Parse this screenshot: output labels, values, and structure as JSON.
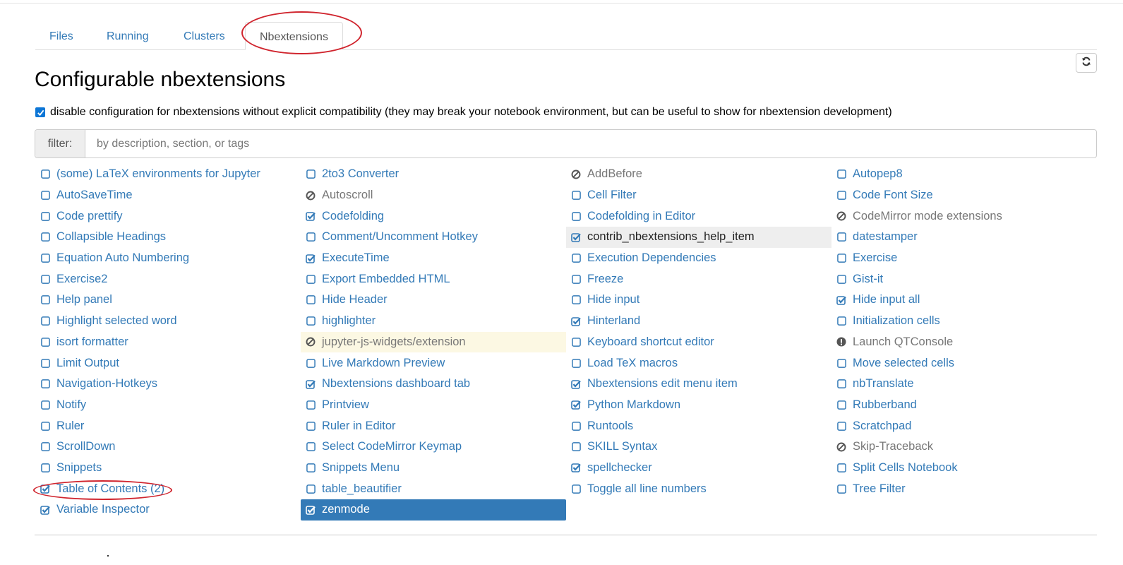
{
  "tabs": [
    {
      "label": "Files",
      "active": false
    },
    {
      "label": "Running",
      "active": false
    },
    {
      "label": "Clusters",
      "active": false
    },
    {
      "label": "Nbextensions",
      "active": true
    }
  ],
  "page_title": "Configurable nbextensions",
  "compat_checkbox": {
    "checked": true,
    "label": "disable configuration for nbextensions without explicit compatibility (they may break your notebook environment, but can be useful to show for nbextension development)"
  },
  "filter": {
    "label": "filter:",
    "placeholder": "by description, section, or tags"
  },
  "refresh_icon": "refresh-icon",
  "annotation_color": "#d0252e",
  "columns": [
    [
      {
        "label": "(some) LaTeX environments for Jupyter",
        "state": "unchecked"
      },
      {
        "label": "AutoSaveTime",
        "state": "unchecked"
      },
      {
        "label": "Code prettify",
        "state": "unchecked"
      },
      {
        "label": "Collapsible Headings",
        "state": "unchecked"
      },
      {
        "label": "Equation Auto Numbering",
        "state": "unchecked"
      },
      {
        "label": "Exercise2",
        "state": "unchecked"
      },
      {
        "label": "Help panel",
        "state": "unchecked"
      },
      {
        "label": "Highlight selected word",
        "state": "unchecked"
      },
      {
        "label": "isort formatter",
        "state": "unchecked"
      },
      {
        "label": "Limit Output",
        "state": "unchecked"
      },
      {
        "label": "Navigation-Hotkeys",
        "state": "unchecked"
      },
      {
        "label": "Notify",
        "state": "unchecked"
      },
      {
        "label": "Ruler",
        "state": "unchecked"
      },
      {
        "label": "ScrollDown",
        "state": "unchecked"
      },
      {
        "label": "Snippets",
        "state": "unchecked"
      },
      {
        "label": "Table of Contents (2)",
        "state": "checked",
        "circled": true
      },
      {
        "label": "Variable Inspector",
        "state": "checked"
      }
    ],
    [
      {
        "label": "2to3 Converter",
        "state": "unchecked"
      },
      {
        "label": "Autoscroll",
        "state": "disabled"
      },
      {
        "label": "Codefolding",
        "state": "checked"
      },
      {
        "label": "Comment/Uncomment Hotkey",
        "state": "unchecked"
      },
      {
        "label": "ExecuteTime",
        "state": "checked"
      },
      {
        "label": "Export Embedded HTML",
        "state": "unchecked"
      },
      {
        "label": "Hide Header",
        "state": "unchecked"
      },
      {
        "label": "highlighter",
        "state": "unchecked"
      },
      {
        "label": "jupyter-js-widgets/extension",
        "state": "disabled",
        "highlight": "yellow"
      },
      {
        "label": "Live Markdown Preview",
        "state": "unchecked"
      },
      {
        "label": "Nbextensions dashboard tab",
        "state": "checked"
      },
      {
        "label": "Printview",
        "state": "unchecked"
      },
      {
        "label": "Ruler in Editor",
        "state": "unchecked"
      },
      {
        "label": "Select CodeMirror Keymap",
        "state": "unchecked"
      },
      {
        "label": "Snippets Menu",
        "state": "unchecked"
      },
      {
        "label": "table_beautifier",
        "state": "unchecked"
      },
      {
        "label": "zenmode",
        "state": "checked",
        "highlight": "blue"
      }
    ],
    [
      {
        "label": "AddBefore",
        "state": "disabled"
      },
      {
        "label": "Cell Filter",
        "state": "unchecked"
      },
      {
        "label": "Codefolding in Editor",
        "state": "unchecked"
      },
      {
        "label": "contrib_nbextensions_help_item",
        "state": "checked",
        "highlight": "grey"
      },
      {
        "label": "Execution Dependencies",
        "state": "unchecked"
      },
      {
        "label": "Freeze",
        "state": "unchecked"
      },
      {
        "label": "Hide input",
        "state": "unchecked"
      },
      {
        "label": "Hinterland",
        "state": "checked"
      },
      {
        "label": "Keyboard shortcut editor",
        "state": "unchecked"
      },
      {
        "label": "Load TeX macros",
        "state": "unchecked"
      },
      {
        "label": "Nbextensions edit menu item",
        "state": "checked"
      },
      {
        "label": "Python Markdown",
        "state": "checked"
      },
      {
        "label": "Runtools",
        "state": "unchecked"
      },
      {
        "label": "SKILL Syntax",
        "state": "unchecked"
      },
      {
        "label": "spellchecker",
        "state": "checked"
      },
      {
        "label": "Toggle all line numbers",
        "state": "unchecked"
      }
    ],
    [
      {
        "label": "Autopep8",
        "state": "unchecked"
      },
      {
        "label": "Code Font Size",
        "state": "unchecked"
      },
      {
        "label": "CodeMirror mode extensions",
        "state": "disabled"
      },
      {
        "label": "datestamper",
        "state": "unchecked"
      },
      {
        "label": "Exercise",
        "state": "unchecked"
      },
      {
        "label": "Gist-it",
        "state": "unchecked"
      },
      {
        "label": "Hide input all",
        "state": "checked"
      },
      {
        "label": "Initialization cells",
        "state": "unchecked"
      },
      {
        "label": "Launch QTConsole",
        "state": "warning"
      },
      {
        "label": "Move selected cells",
        "state": "unchecked"
      },
      {
        "label": "nbTranslate",
        "state": "unchecked"
      },
      {
        "label": "Rubberband",
        "state": "unchecked"
      },
      {
        "label": "Scratchpad",
        "state": "unchecked"
      },
      {
        "label": "Skip-Traceback",
        "state": "disabled"
      },
      {
        "label": "Split Cells Notebook",
        "state": "unchecked"
      },
      {
        "label": "Tree Filter",
        "state": "unchecked"
      }
    ]
  ]
}
